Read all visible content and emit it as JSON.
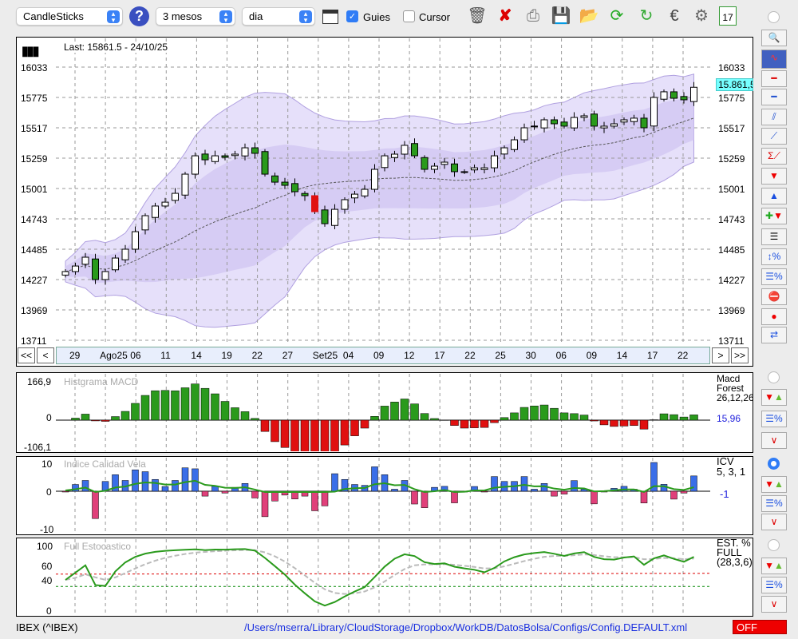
{
  "toolbar": {
    "chart_type": "CandleSticks",
    "period": "3 mesos",
    "interval": "dia",
    "guides_label": "Guies",
    "guides_checked": true,
    "cursor_label": "Cursor",
    "cursor_checked": false
  },
  "main": {
    "last_label": "Last: 15861.5 - 24/10/25",
    "price_badge": "15.861,5",
    "y_ticks": [
      "16033",
      "15775",
      "15517",
      "15259",
      "15001",
      "14743",
      "14485",
      "14227",
      "13969",
      "13711"
    ],
    "date_labels": [
      "29",
      "Ago25",
      "06",
      "11",
      "14",
      "19",
      "22",
      "27",
      "Set25",
      "04",
      "09",
      "12",
      "17",
      "22",
      "25",
      "30",
      "06",
      "09",
      "14",
      "17",
      "22"
    ],
    "nav": {
      "first": "<<",
      "prev": "<",
      "next": ">",
      "last": ">>"
    },
    "closes": [
      14295,
      14342,
      14417,
      14227,
      14295,
      14410,
      14485,
      14634,
      14770,
      14852,
      14885,
      14960,
      15123,
      15279,
      15245,
      15279,
      15266,
      15293,
      15347,
      15300,
      15123,
      15055,
      15028,
      14974,
      14940,
      14804,
      14702,
      14824,
      14906,
      14953,
      14994,
      15164,
      15279,
      15293,
      15368,
      15279,
      15164,
      15191,
      15225,
      15144,
      15144,
      15177,
      15177,
      15279,
      15347,
      15415,
      15517,
      15531,
      15585,
      15551,
      15531,
      15605,
      15619,
      15531,
      15531,
      15551,
      15585,
      15599,
      15517,
      15775,
      15823,
      15768,
      15755,
      15861.5
    ],
    "colors": {
      "up": "#2a9a1c",
      "down": "#e01010",
      "band": "#d8d0f4"
    }
  },
  "macd": {
    "title": "Histgrama MACD",
    "y_ticks": [
      "166,9",
      "0",
      "-106,1"
    ],
    "name": "Macd",
    "sub": "Forest",
    "params": "26,12,26",
    "value": "15,96"
  },
  "icv": {
    "title": "Indice Calidad Vela",
    "y_ticks": [
      "10",
      "0",
      "-10"
    ],
    "name": "ICV",
    "params": "5, 3, 1",
    "value": "-1"
  },
  "stoch": {
    "title": "Full Estocastico",
    "y_ticks": [
      "100",
      "60",
      "40",
      "0"
    ],
    "name": "EST. %",
    "sub": "FULL",
    "params": "(28,3,6)"
  },
  "status": {
    "ticker": "IBEX (^IBEX)",
    "path": "/Users/mserra/Library/CloudStorage/Dropbox/WorkDB/DatosBolsa/Configs/Config.DEFAULT.xml",
    "state": "OFF"
  }
}
